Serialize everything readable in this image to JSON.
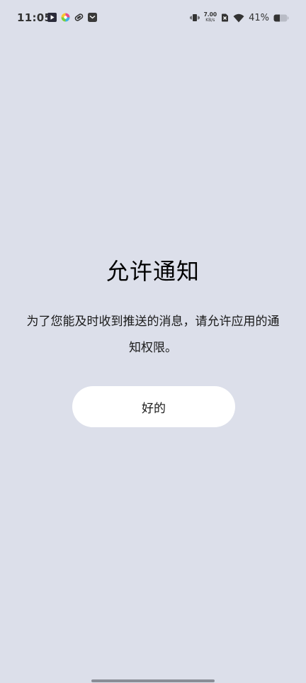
{
  "status_bar": {
    "time": "11:05",
    "notification_icons": [
      "media-play-icon",
      "colorful-app-icon",
      "sync-app-icon",
      "mail-app-icon"
    ],
    "net_speed_value": "7.00",
    "net_speed_unit": "KB/s",
    "battery_percent": "41%"
  },
  "dialog": {
    "title": "允许通知",
    "message": "为了您能及时收到推送的消息，请允许应用的通知权限。",
    "ok_label": "好的"
  },
  "colors": {
    "background": "#dcdfea",
    "button": "#ffffff",
    "text": "#1a1a1a"
  }
}
